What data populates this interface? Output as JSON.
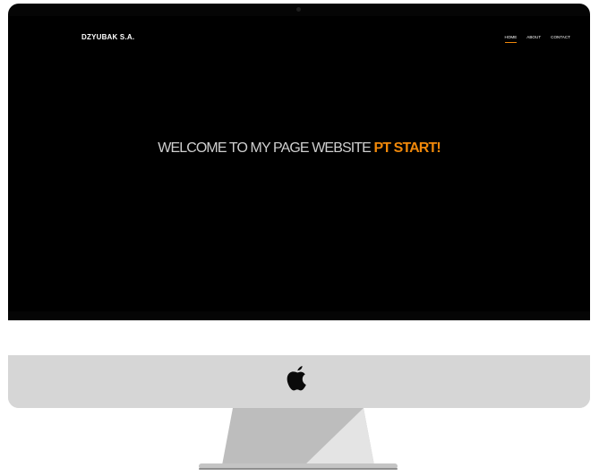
{
  "site": {
    "brand": "DZYUBAK S.A.",
    "nav": [
      {
        "label": "HOME",
        "active": true
      },
      {
        "label": "ABOUT",
        "active": false
      },
      {
        "label": "CONTACT",
        "active": false
      }
    ],
    "hero": {
      "main_text": "WELCOME TO MY PAGE WEBSITE",
      "accent_text": "PT START!"
    }
  },
  "colors": {
    "accent": "#f0880a",
    "screen": "#000000",
    "frame": "#d6d6d6",
    "hero_text": "#cfcfcf"
  },
  "icons": {
    "logo": "apple-icon"
  }
}
